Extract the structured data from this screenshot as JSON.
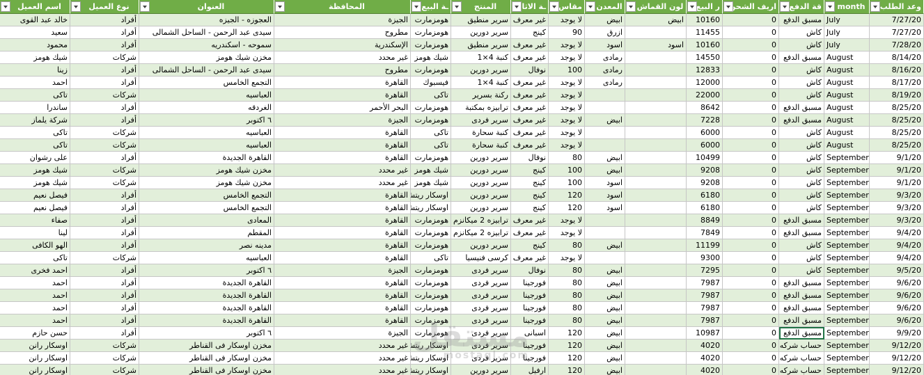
{
  "columns": [
    {
      "label": "اسم العميل",
      "align": "rtl"
    },
    {
      "label": "نوع العميل",
      "align": "rtl"
    },
    {
      "label": "العنوان",
      "align": "rtl"
    },
    {
      "label": "المحافظة",
      "align": "rtl"
    },
    {
      "label": "ـة البيع",
      "align": "rtl"
    },
    {
      "label": "المنتج",
      "align": "rtl"
    },
    {
      "label": "ـة الاثاث",
      "align": "rtl"
    },
    {
      "label": "مقاس",
      "align": "rtl"
    },
    {
      "label": "المعدن",
      "align": "rtl"
    },
    {
      "label": "لون القماش",
      "align": "rtl"
    },
    {
      "label": "ر البيع",
      "align": "num"
    },
    {
      "label": "اريف الشحن",
      "align": "num"
    },
    {
      "label": "قة الدفع",
      "align": "rtl"
    },
    {
      "label": "month",
      "align": "ltr"
    },
    {
      "label": "وعد الطلب",
      "align": "num"
    }
  ],
  "rows": [
    [
      "خالد عبد القوى",
      "أفراد",
      "العجوزه - الجيزه",
      "الجيزة",
      "هومزمارت",
      "سرير منطيق",
      "غير معرف",
      "لا يوجد",
      "ابيض",
      "ابيض",
      "10160",
      "0",
      "مسبق الدفع",
      "July",
      "7/27/20"
    ],
    [
      "سعيد",
      "أفراد",
      "سيدى عبد الرحمن - الساحل الشمالى",
      "مطروح",
      "هومزمارت",
      "سرير دورين",
      "كينج",
      "90",
      "ازرق",
      "",
      "11455",
      "0",
      "كاش",
      "July",
      "7/27/20"
    ],
    [
      "محمود",
      "أفراد",
      "سموحه - اسكندريه",
      "الإسكندرية",
      "هومزمارت",
      "سرير منطيق",
      "غير معرف",
      "لا يوجد",
      "اسود",
      "اسود",
      "10160",
      "0",
      "كاش",
      "July",
      "7/28/20"
    ],
    [
      "شيك هومز",
      "شركات",
      "مخزن شيك هومز",
      "غير محدد",
      "شيك هومز",
      "كنبة 4×1",
      "غير معرف",
      "لا يوجد",
      "رمادى",
      "",
      "14550",
      "0",
      "مسبق الدفع",
      "August",
      "8/14/20"
    ],
    [
      "زينا",
      "أفراد",
      "سيدى عبد الرحمن - الساحل الشمالى",
      "مطروح",
      "هومزمارت",
      "سرير دورين",
      "نوفال",
      "100",
      "رمادى",
      "",
      "12833",
      "0",
      "كاش",
      "August",
      "8/16/20"
    ],
    [
      "احمد",
      "أفراد",
      "التجمع الخامس",
      "القاهرة",
      "فيسبوك",
      "كنبة 4×1",
      "غير معرف",
      "لا يوجد",
      "رمادى",
      "",
      "12000",
      "0",
      "كاش",
      "August",
      "8/17/20"
    ],
    [
      "تاكى",
      "شركات",
      "العباسيه",
      "القاهرة",
      "تاكى",
      "ركنة بسرير",
      "غير معرف",
      "لا يوجد",
      "",
      "",
      "22000",
      "0",
      "كاش",
      "August",
      "8/19/20"
    ],
    [
      "ساندرا",
      "أفراد",
      "الغردقه",
      "البحر الأحمر",
      "هومزمارت",
      "ترابيزه بمكتبة",
      "غير معرف",
      "لا يوجد",
      "",
      "",
      "8642",
      "0",
      "مسبق الدفع",
      "August",
      "8/25/20"
    ],
    [
      "شركة يلماز",
      "أفراد",
      "٦ اكتوبر",
      "الجيزة",
      "هومزمارت",
      "سرير فردى",
      "غير معرف",
      "لا يوجد",
      "ابيض",
      "",
      "7228",
      "0",
      "مسبق الدفع",
      "August",
      "8/25/20"
    ],
    [
      "تاكى",
      "شركات",
      "العباسيه",
      "القاهرة",
      "تاكى",
      "كنبة سحارة",
      "غير معرف",
      "لا يوجد",
      "",
      "",
      "6000",
      "0",
      "كاش",
      "August",
      "8/25/20"
    ],
    [
      "تاكى",
      "شركات",
      "العباسيه",
      "القاهرة",
      "تاكى",
      "كنبة سحارة",
      "غير معرف",
      "لا يوجد",
      "",
      "",
      "6000",
      "0",
      "كاش",
      "August",
      "8/25/20"
    ],
    [
      "على رشوان",
      "أفراد",
      "القاهرة الجديدة",
      "القاهرة",
      "هومزمارت",
      "سرير دورين",
      "نوفال",
      "80",
      "ابيض",
      "",
      "10499",
      "0",
      "كاش",
      "September",
      "9/1/20"
    ],
    [
      "شيك هومز",
      "شركات",
      "مخزن شيك هومز",
      "غير محدد",
      "شيك هومز",
      "سرير دورين",
      "كينج",
      "100",
      "ابيض",
      "",
      "9208",
      "0",
      "كاش",
      "September",
      "9/1/20"
    ],
    [
      "شيك هومز",
      "شركات",
      "مخزن شيك هومز",
      "غير محدد",
      "شيك هومز",
      "سرير دورين",
      "كينج",
      "100",
      "اسود",
      "",
      "9208",
      "0",
      "كاش",
      "September",
      "9/1/20"
    ],
    [
      "فيصل نعيم",
      "أفراد",
      "التجمع الخامس",
      "القاهرة",
      "اوسكار ريتش",
      "سرير دورين",
      "كينج",
      "120",
      "اسود",
      "",
      "6180",
      "0",
      "كاش",
      "September",
      "9/3/20"
    ],
    [
      "فيصل نعيم",
      "أفراد",
      "التجمع الخامس",
      "القاهرة",
      "اوسكار ريتش",
      "سرير دورين",
      "كينج",
      "120",
      "اسود",
      "",
      "6180",
      "0",
      "كاش",
      "September",
      "9/3/20"
    ],
    [
      "صفاء",
      "أفراد",
      "المعادى",
      "القاهرة",
      "هومزمارت",
      "ترابيزه 2 ميكانزم",
      "غير معرف",
      "لا يوجد",
      "",
      "",
      "8849",
      "0",
      "مسبق الدفع",
      "September",
      "9/3/20"
    ],
    [
      "لينا",
      "أفراد",
      "المقطم",
      "القاهرة",
      "هومزمارت",
      "ترابيزه 2 ميكانزم",
      "غير معرف",
      "لا يوجد",
      "",
      "",
      "7849",
      "0",
      "مسبق الدفع",
      "September",
      "9/4/20"
    ],
    [
      "الهو الكافى",
      "أفراد",
      "مدينه نصر",
      "القاهرة",
      "هومزمارت",
      "سرير دورين",
      "كينج",
      "80",
      "ابيض",
      "",
      "11199",
      "0",
      "كاش",
      "September",
      "9/4/20"
    ],
    [
      "تاكى",
      "شركات",
      "العباسيه",
      "القاهرة",
      "تاكى",
      "كرسى فنيسيا",
      "غير معرف",
      "لا يوجد",
      "",
      "",
      "9300",
      "0",
      "كاش",
      "September",
      "9/4/20"
    ],
    [
      "احمد فخرى",
      "أفراد",
      "٦ اكتوبر",
      "الجيزة",
      "هومزمارت",
      "سرير فردى",
      "نوفال",
      "80",
      "ابيض",
      "",
      "7295",
      "0",
      "كاش",
      "September",
      "9/5/20"
    ],
    [
      "احمد",
      "أفراد",
      "القاهرة الجديدة",
      "القاهرة",
      "هومزمارت",
      "سرير فردى",
      "فورجينا",
      "80",
      "ابيض",
      "",
      "7987",
      "0",
      "مسبق الدفع",
      "September",
      "9/6/20"
    ],
    [
      "احمد",
      "أفراد",
      "القاهرة الجديدة",
      "القاهرة",
      "هومزمارت",
      "سرير فردى",
      "فورجينا",
      "80",
      "ابيض",
      "",
      "7987",
      "0",
      "مسبق الدفع",
      "September",
      "9/6/20"
    ],
    [
      "احمد",
      "أفراد",
      "القاهرة الجديدة",
      "القاهرة",
      "هومزمارت",
      "سرير فردى",
      "فورجينا",
      "80",
      "ابيض",
      "",
      "7987",
      "0",
      "مسبق الدفع",
      "September",
      "9/6/20"
    ],
    [
      "احمد",
      "أفراد",
      "القاهرة الجديدة",
      "القاهرة",
      "هومزمارت",
      "سرير فردى",
      "فورجينا",
      "80",
      "ابيض",
      "",
      "7987",
      "0",
      "مسبق الدفع",
      "September",
      "9/6/20"
    ],
    [
      "حسن حازم",
      "أفراد",
      "٦ اكتوبر",
      "الجيزة",
      "هومزمارت",
      "سرير فردى",
      "اسبانى",
      "120",
      "ابيض",
      "",
      "10987",
      "0",
      "مسبق الدفع",
      "September",
      "9/9/20"
    ],
    [
      "اوسكار رانن",
      "شركات",
      "مخزن اوسكار فى القناطر",
      "غير محدد",
      "اوسكار ريتش",
      "سرير فردى",
      "فورجينا",
      "120",
      "ابيض",
      "",
      "4020",
      "0",
      "حساب شركه",
      "September",
      "9/12/20"
    ],
    [
      "اوسكار رانن",
      "شركات",
      "مخزن اوسكار فى القناطر",
      "غير محدد",
      "اوسكار ريتش",
      "سرير فردى",
      "فورجينا",
      "120",
      "ابيض",
      "",
      "4020",
      "0",
      "حساب شركه",
      "September",
      "9/12/20"
    ],
    [
      "اوسكار رانن",
      "شركات",
      "مخزن اوسكار فى القناطر",
      "غير محدد",
      "اوسكار ريتش",
      "سرير دورين",
      "ارفيل",
      "120",
      "ابيض",
      "",
      "4020",
      "0",
      "حساب شركه",
      "September",
      "9/12/20"
    ]
  ],
  "selected_cell": {
    "row": 25,
    "col": 12
  },
  "watermark": {
    "text": "مستقل",
    "sub": "mostaql.com"
  },
  "colors": {
    "header": "#70ad47",
    "band": "#e2efda",
    "grid": "#c6c6c6"
  }
}
